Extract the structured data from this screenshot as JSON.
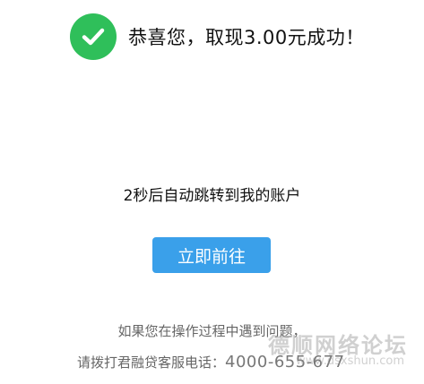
{
  "success": {
    "message": "恭喜您，取现3.00元成功！",
    "icon": "check-circle-icon",
    "icon_color": "#2fbf5a"
  },
  "redirect": {
    "message": "2秒后自动跳转到我的账户"
  },
  "action": {
    "button_label": "立即前往",
    "button_color": "#3aa0ea"
  },
  "help": {
    "line1": "如果您在操作过程中遇到问题，",
    "line2_prefix": "请拨打君融贷客服电话：",
    "phone": "4000-655-677"
  },
  "watermark": {
    "text": "德顺网络论坛",
    "sub": "www.dsxshun.com"
  }
}
